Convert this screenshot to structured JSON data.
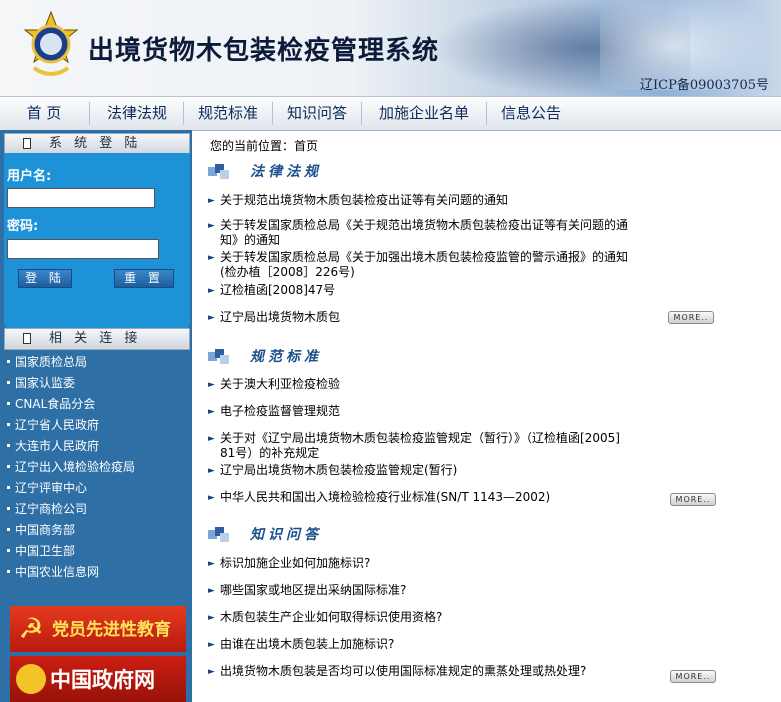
{
  "header": {
    "title": "出境货物木包装检疫管理系统",
    "icp": "辽ICP备09003705号"
  },
  "nav": [
    "首 页",
    "法律法规",
    "规范标准",
    "知识问答",
    "加施企业名单",
    "信息公告"
  ],
  "sidebar": {
    "login_title": "系 统 登 陆",
    "username_label": "用户名:",
    "password_label": "密码:",
    "login_button": "登 陆",
    "reset_button": "重 置",
    "links_title": "相 关 连 接",
    "links": [
      "国家质检总局",
      "国家认监委",
      "CNAL食品分会",
      "辽宁省人民政府",
      "大连市人民政府",
      "辽宁出入境检验检疫局",
      "辽宁评审中心",
      "辽宁商检公司",
      "中国商务部",
      "中国卫生部",
      "中国农业信息网"
    ],
    "banner1": "党员先进性教育",
    "banner2": "中国政府网"
  },
  "main": {
    "breadcrumb": "您的当前位置：首页",
    "sections": [
      {
        "title": "法律法规",
        "items": [
          [
            "关于规范出境货物木质包装检疫出证等有关问题的通知"
          ],
          [
            "关于转发国家质检总局《关于规范出境货物木质包装检疫出证等有关问题的通",
            "知》的通知"
          ],
          [
            "关于转发国家质检总局《关于加强出境木质包装检疫监管的警示通报》的通知",
            "(检办植［2008］226号)"
          ],
          [
            "辽检植函[2008]47号"
          ],
          [
            "辽宁局出境货物木质包"
          ]
        ]
      },
      {
        "title": "规范标准",
        "items": [
          [
            "关于澳大利亚检疫检验"
          ],
          [
            "电子检疫监督管理规范"
          ],
          [
            "关于对《辽宁局出境货物木质包装检疫监管规定（暂行）》（辽检植函[2005]",
            "81号）的补充规定"
          ],
          [
            "辽宁局出境货物木质包装检疫监管规定(暂行)"
          ],
          [
            "中华人民共和国出入境检验检疫行业标准(SN/T 1143—2002)"
          ]
        ]
      },
      {
        "title": "知识问答",
        "items": [
          [
            "标识加施企业如何加施标识?"
          ],
          [
            "哪些国家或地区提出采纳国际标准?"
          ],
          [
            "木质包装生产企业如何取得标识使用资格?"
          ],
          [
            "由谁在出境木质包装上加施标识?"
          ],
          [
            "出境货物木质包装是否均可以使用国际标准规定的熏蒸处理或热处理?"
          ]
        ]
      }
    ],
    "more_label": "MORE.."
  }
}
